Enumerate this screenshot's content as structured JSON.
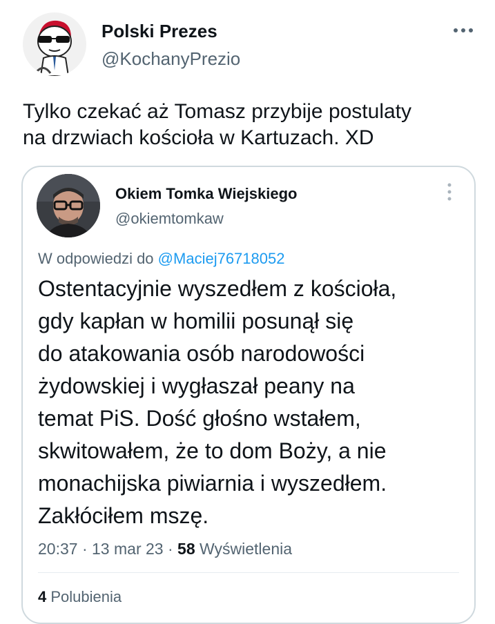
{
  "author": {
    "display_name": "Polski Prezes",
    "handle": "@KochanyPrezio",
    "avatar_icon": "cartoon-man-with-sunglasses-avatar"
  },
  "tweet": {
    "text_line1": "Tylko czekać aż Tomasz przybije postulaty",
    "text_line2": "na drzwiach kościoła w Kartuzach. XD"
  },
  "quoted": {
    "display_name": "Okiem Tomka Wiejskiego",
    "handle": "@okiemtomkaw",
    "avatar_icon": "man-with-glasses-photo-avatar",
    "reply_prefix": "W odpowiedzi do",
    "reply_user": "@Maciej76718052",
    "body_lines": [
      "Ostentacyjnie wyszedłem z kościoła,",
      "gdy kapłan w homilii posunął się",
      "do atakowania osób narodowości",
      "żydowskiej i wygłaszał peany na",
      "temat PiS. Dość głośno wstałem,",
      "skwitowałem, że to dom Boży, a nie",
      "monachijska piwiarnia i wyszedłem.",
      "Zakłóciłem mszę."
    ],
    "time": "20:37",
    "date": "13 mar 23",
    "views_count": "58",
    "views_label": "Wyświetlenia",
    "stats_count": "4",
    "stats_label": "Polubienia"
  },
  "colors": {
    "text": "#0f1419",
    "secondary": "#536471",
    "link": "#1d9bf0",
    "border": "#cfd9de"
  }
}
